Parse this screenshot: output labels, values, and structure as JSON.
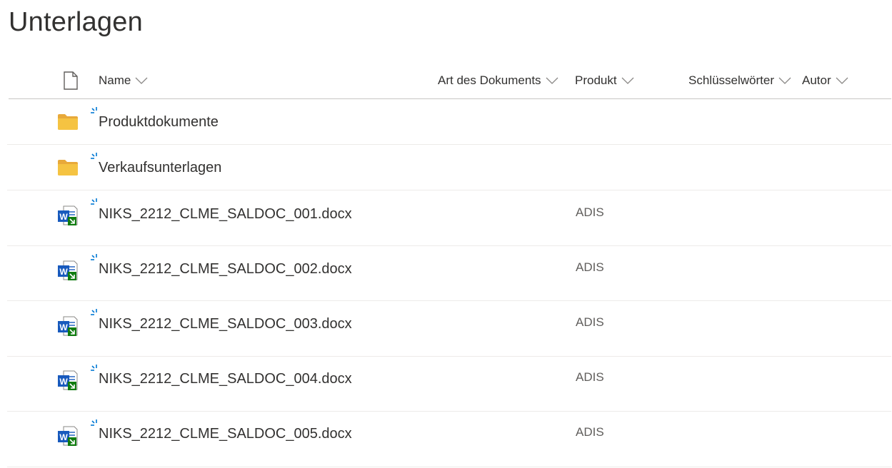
{
  "page": {
    "title": "Unterlagen"
  },
  "columns": {
    "type_icon": "document-icon",
    "name": "Name",
    "art": "Art des Dokuments",
    "produkt": "Produkt",
    "schluessel": "Schlüsselwörter",
    "autor": "Autor"
  },
  "items": [
    {
      "name": "Produktdokumente",
      "type": "folder",
      "produkt": ""
    },
    {
      "name": "Verkaufsunterlagen",
      "type": "folder",
      "produkt": ""
    },
    {
      "name": "NIKS_2212_CLME_SALDOC_001.docx",
      "type": "word",
      "produkt": "ADIS"
    },
    {
      "name": "NIKS_2212_CLME_SALDOC_002.docx",
      "type": "word",
      "produkt": "ADIS"
    },
    {
      "name": "NIKS_2212_CLME_SALDOC_003.docx",
      "type": "word",
      "produkt": "ADIS"
    },
    {
      "name": "NIKS_2212_CLME_SALDOC_004.docx",
      "type": "word",
      "produkt": "ADIS"
    },
    {
      "name": "NIKS_2212_CLME_SALDOC_005.docx",
      "type": "word",
      "produkt": "ADIS"
    }
  ],
  "colors": {
    "folder": "#f5c342",
    "word_blue": "#185abd",
    "word_green": "#107c10",
    "spark": "#0078d4"
  }
}
